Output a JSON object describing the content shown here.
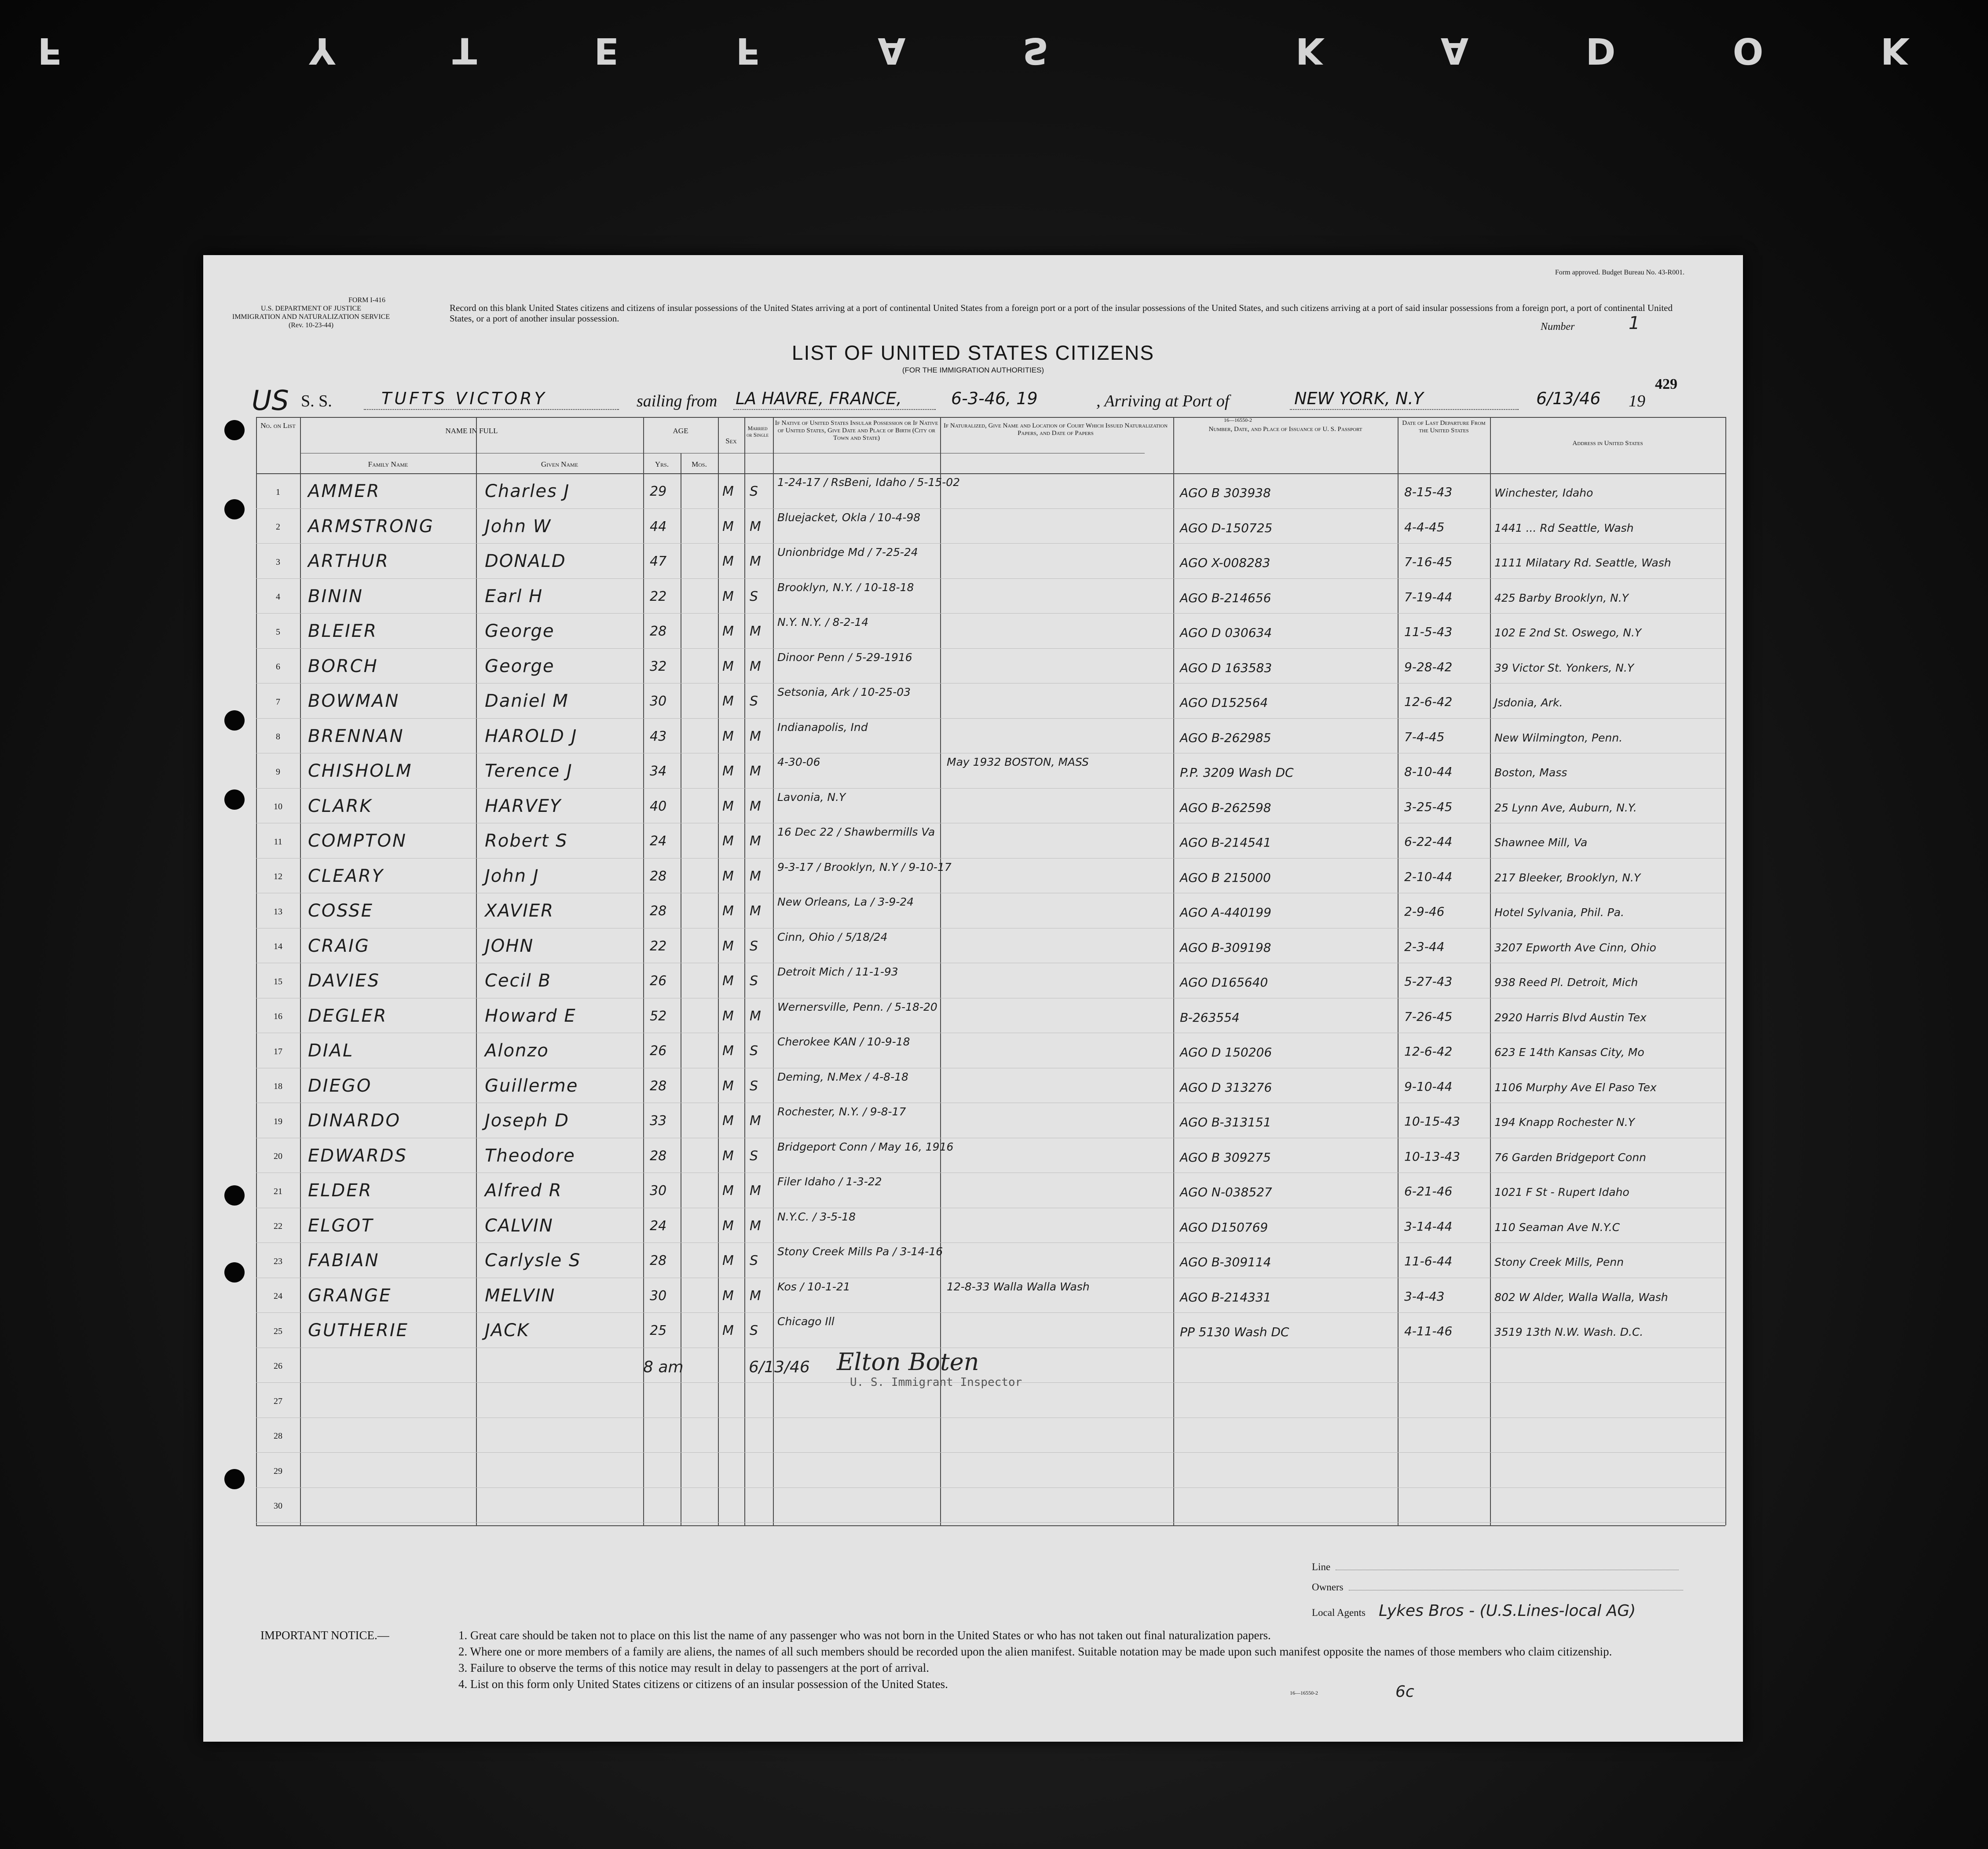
{
  "film_edge": {
    "text": "KODAK SAFETY F"
  },
  "form": {
    "department": "U.S. DEPARTMENT OF JUSTICE",
    "service": "IMMIGRATION AND NATURALIZATION SERVICE",
    "form_no": "FORM I-416",
    "revision": "(Rev. 10-23-44)",
    "budget": "Form approved. Budget Bureau No. 43-R001.",
    "top_notice": "Record on this blank United States citizens and citizens of insular possessions of the United States arriving at a port of continental United States from a foreign port or a port of the insular possessions of the United States, and such citizens arriving at a port of said insular possessions from a foreign port, a port of continental United States, or a port of another insular possession.",
    "title": "LIST OF UNITED STATES CITIZENS",
    "subtitle": "(FOR THE IMMIGRATION AUTHORITIES)",
    "number_label": "Number",
    "number_value": "1",
    "page_stamp": "429",
    "printer_code": "16—16550-2",
    "bottom_code": "16—16550-2"
  },
  "voyage": {
    "us_mark": "US",
    "ss_label": "S. S.",
    "ship": "TUFTS VICTORY",
    "sailing_label": "sailing from",
    "from_port": "LA HAVRE, FRANCE,",
    "date": "6-3-46, 19",
    "arriving_label": ", Arriving at Port of",
    "to_port": "NEW YORK, N.Y",
    "arrival_date": "6/13/46",
    "arrival_year": "19"
  },
  "table": {
    "headers": {
      "no": "No. on List",
      "name_in_full": "NAME IN FULL",
      "family": "Family Name",
      "given": "Given Name",
      "age": "AGE",
      "yrs": "Yrs.",
      "mos": "Mos.",
      "sex": "Sex",
      "married": "Married or Single",
      "native": "If Native of United States Insular Possession or If Native of United States, Give Date and Place of Birth (City or Town and State)",
      "naturalized": "If Naturalized, Give Name and Location of Court Which Issued Naturalization Papers, and Date of Papers",
      "passport": "Number, Date, and Place of Issuance of U. S. Passport",
      "departure": "Date of Last Departure From the United States",
      "address": "Address in United States"
    },
    "row_numbers": [
      "1",
      "2",
      "3",
      "4",
      "5",
      "6",
      "7",
      "8",
      "9",
      "10",
      "11",
      "12",
      "13",
      "14",
      "15",
      "16",
      "17",
      "18",
      "19",
      "20",
      "21",
      "22",
      "23",
      "24",
      "25",
      "26",
      "27",
      "28",
      "29",
      "30"
    ],
    "rows": [
      {
        "family": "AMMER",
        "given": "Charles J",
        "yrs": "29",
        "sex": "M",
        "ms": "S",
        "birth": "1-24-17 / RsBeni, Idaho / 5-15-02",
        "nat": "",
        "passport": "AGO B 303938",
        "departure": "8-15-43",
        "address": "Winchester, Idaho"
      },
      {
        "family": "ARMSTRONG",
        "given": "John W",
        "yrs": "44",
        "sex": "M",
        "ms": "M",
        "birth": "Bluejacket, Okla / 10-4-98",
        "nat": "",
        "passport": "AGO D-150725",
        "departure": "4-4-45",
        "address": "1441 ... Rd Seattle, Wash"
      },
      {
        "family": "ARTHUR",
        "given": "DONALD",
        "yrs": "47",
        "sex": "M",
        "ms": "M",
        "birth": "Unionbridge Md / 7-25-24",
        "nat": "",
        "passport": "AGO X-008283",
        "departure": "7-16-45",
        "address": "1111 Milatary Rd. Seattle, Wash"
      },
      {
        "family": "BININ",
        "given": "Earl H",
        "yrs": "22",
        "sex": "M",
        "ms": "S",
        "birth": "Brooklyn, N.Y. / 10-18-18",
        "nat": "",
        "passport": "AGO B-214656",
        "departure": "7-19-44",
        "address": "425 Barby Brooklyn, N.Y"
      },
      {
        "family": "BLEIER",
        "given": "George",
        "yrs": "28",
        "sex": "M",
        "ms": "M",
        "birth": "N.Y. N.Y. / 8-2-14",
        "nat": "",
        "passport": "AGO D 030634",
        "departure": "11-5-43",
        "address": "102 E 2nd St. Oswego, N.Y"
      },
      {
        "family": "BORCH",
        "given": "George",
        "yrs": "32",
        "sex": "M",
        "ms": "M",
        "birth": "Dinoor Penn / 5-29-1916",
        "nat": "",
        "passport": "AGO D 163583",
        "departure": "9-28-42",
        "address": "39 Victor St. Yonkers, N.Y"
      },
      {
        "family": "BOWMAN",
        "given": "Daniel M",
        "yrs": "30",
        "sex": "M",
        "ms": "S",
        "birth": "Setsonia, Ark / 10-25-03",
        "nat": "",
        "passport": "AGO D152564",
        "departure": "12-6-42",
        "address": "Jsdonia, Ark."
      },
      {
        "family": "BRENNAN",
        "given": "HAROLD J",
        "yrs": "43",
        "sex": "M",
        "ms": "M",
        "birth": "Indianapolis, Ind",
        "nat": "",
        "passport": "AGO B-262985",
        "departure": "7-4-45",
        "address": "New Wilmington, Penn."
      },
      {
        "family": "CHISHOLM",
        "given": "Terence J",
        "yrs": "34",
        "sex": "M",
        "ms": "M",
        "birth": "4-30-06",
        "nat": "May 1932 BOSTON, MASS",
        "passport": "P.P. 3209 Wash DC",
        "departure": "8-10-44",
        "address": "Boston, Mass"
      },
      {
        "family": "CLARK",
        "given": "HARVEY",
        "yrs": "40",
        "sex": "M",
        "ms": "M",
        "birth": "Lavonia, N.Y",
        "nat": "",
        "passport": "AGO B-262598",
        "departure": "3-25-45",
        "address": "25 Lynn Ave, Auburn, N.Y."
      },
      {
        "family": "COMPTON",
        "given": "Robert S",
        "yrs": "24",
        "sex": "M",
        "ms": "M",
        "birth": "16 Dec 22 / Shawbermills Va",
        "nat": "",
        "passport": "AGO B-214541",
        "departure": "6-22-44",
        "address": "Shawnee Mill, Va"
      },
      {
        "family": "CLEARY",
        "given": "John J",
        "yrs": "28",
        "sex": "M",
        "ms": "M",
        "birth": "9-3-17 / Brooklyn, N.Y / 9-10-17",
        "nat": "",
        "passport": "AGO B 215000",
        "departure": "2-10-44",
        "address": "217 Bleeker, Brooklyn, N.Y"
      },
      {
        "family": "COSSE",
        "given": "XAVIER",
        "yrs": "28",
        "sex": "M",
        "ms": "M",
        "birth": "New Orleans, La / 3-9-24",
        "nat": "",
        "passport": "AGO A-440199",
        "departure": "2-9-46",
        "address": "Hotel Sylvania, Phil. Pa."
      },
      {
        "family": "CRAIG",
        "given": "JOHN",
        "yrs": "22",
        "sex": "M",
        "ms": "S",
        "birth": "Cinn, Ohio / 5/18/24",
        "nat": "",
        "passport": "AGO B-309198",
        "departure": "2-3-44",
        "address": "3207 Epworth Ave Cinn, Ohio"
      },
      {
        "family": "DAVIES",
        "given": "Cecil B",
        "yrs": "26",
        "sex": "M",
        "ms": "S",
        "birth": "Detroit Mich / 11-1-93",
        "nat": "",
        "passport": "AGO D165640",
        "departure": "5-27-43",
        "address": "938 Reed Pl. Detroit, Mich"
      },
      {
        "family": "DEGLER",
        "given": "Howard E",
        "yrs": "52",
        "sex": "M",
        "ms": "M",
        "birth": "Wernersville, Penn. / 5-18-20",
        "nat": "",
        "passport": "B-263554",
        "departure": "7-26-45",
        "address": "2920 Harris Blvd Austin Tex"
      },
      {
        "family": "DIAL",
        "given": "Alonzo",
        "yrs": "26",
        "sex": "M",
        "ms": "S",
        "birth": "Cherokee KAN / 10-9-18",
        "nat": "",
        "passport": "AGO D 150206",
        "departure": "12-6-42",
        "address": "623 E 14th Kansas City, Mo"
      },
      {
        "family": "DIEGO",
        "given": "Guillerme",
        "yrs": "28",
        "sex": "M",
        "ms": "S",
        "birth": "Deming, N.Mex / 4-8-18",
        "nat": "",
        "passport": "AGO D 313276",
        "departure": "9-10-44",
        "address": "1106 Murphy Ave El Paso Tex"
      },
      {
        "family": "DINARDO",
        "given": "Joseph D",
        "yrs": "33",
        "sex": "M",
        "ms": "M",
        "birth": "Rochester, N.Y. / 9-8-17",
        "nat": "",
        "passport": "AGO B-313151",
        "departure": "10-15-43",
        "address": "194 Knapp Rochester N.Y"
      },
      {
        "family": "EDWARDS",
        "given": "Theodore",
        "yrs": "28",
        "sex": "M",
        "ms": "S",
        "birth": "Bridgeport Conn / May 16, 1916",
        "nat": "",
        "passport": "AGO B 309275",
        "departure": "10-13-43",
        "address": "76 Garden Bridgeport Conn"
      },
      {
        "family": "ELDER",
        "given": "Alfred R",
        "yrs": "30",
        "sex": "M",
        "ms": "M",
        "birth": "Filer Idaho / 1-3-22",
        "nat": "",
        "passport": "AGO N-038527",
        "departure": "6-21-46",
        "address": "1021 F St - Rupert Idaho"
      },
      {
        "family": "ELGOT",
        "given": "CALVIN",
        "yrs": "24",
        "sex": "M",
        "ms": "M",
        "birth": "N.Y.C. / 3-5-18",
        "nat": "",
        "passport": "AGO D150769",
        "departure": "3-14-44",
        "address": "110 Seaman Ave N.Y.C"
      },
      {
        "family": "FABIAN",
        "given": "Carlysle S",
        "yrs": "28",
        "sex": "M",
        "ms": "S",
        "birth": "Stony Creek Mills Pa / 3-14-16",
        "nat": "",
        "passport": "AGO B-309114",
        "departure": "11-6-44",
        "address": "Stony Creek Mills, Penn"
      },
      {
        "family": "GRANGE",
        "given": "MELVIN",
        "yrs": "30",
        "sex": "M",
        "ms": "M",
        "birth": "Kos / 10-1-21",
        "nat": "12-8-33 Walla Walla Wash",
        "passport": "AGO B-214331",
        "departure": "3-4-43",
        "address": "802 W Alder, Walla Walla, Wash"
      },
      {
        "family": "GUTHERIE",
        "given": "JACK",
        "yrs": "25",
        "sex": "M",
        "ms": "S",
        "birth": "Chicago Ill",
        "nat": "",
        "passport": "PP 5130 Wash DC",
        "departure": "4-11-46",
        "address": "3519 13th N.W. Wash. D.C."
      }
    ]
  },
  "signature": {
    "time": "8 am",
    "date": "6/13/46",
    "name": "Elton Boten",
    "title": "U. S. Immigrant Inspector"
  },
  "agents": {
    "line_label": "Line",
    "owners_label": "Owners",
    "local_agents_label": "Local Agents",
    "local_agents_value": "Lykes Bros - (U.S.Lines-local AG)"
  },
  "important_notice": {
    "heading": "IMPORTANT NOTICE.—",
    "items": [
      "1. Great care should be taken not to place on this list the name of any passenger who was not born in the United States or who has not taken out final naturalization papers.",
      "2. Where one or more members of a family are aliens, the names of all such members should be recorded upon the alien manifest. Suitable notation may be made upon such manifest opposite the names of those members who claim citizenship.",
      "3. Failure to observe the terms of this notice may result in delay to passengers at the port of arrival.",
      "4. List on this form only United States citizens or citizens of an insular possession of the United States."
    ],
    "mark": "6c"
  }
}
